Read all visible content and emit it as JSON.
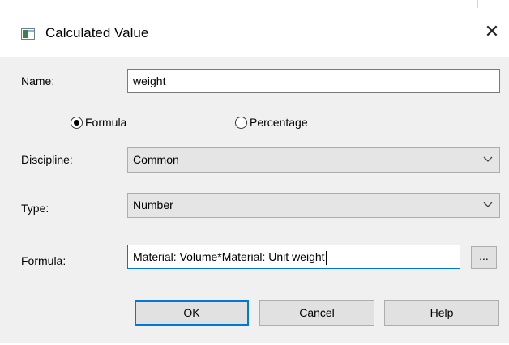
{
  "window": {
    "title": "Calculated Value",
    "close_label": "✕",
    "icon": "app-window-icon"
  },
  "form": {
    "name_label": "Name:",
    "name_value": "weight",
    "formula_radio_label": "Formula",
    "percentage_radio_label": "Percentage",
    "selected_mode": "Formula",
    "discipline_label": "Discipline:",
    "discipline_value": "Common",
    "type_label": "Type:",
    "type_value": "Number",
    "formula_label": "Formula:",
    "formula_value": "Material: Volume*Material: Unit weight",
    "formula_browse_label": "..."
  },
  "buttons": {
    "ok_label": "OK",
    "cancel_label": "Cancel",
    "help_label": "Help"
  },
  "colors": {
    "focus_border": "#0078d7",
    "dialog_bg": "#f0f0f0"
  }
}
